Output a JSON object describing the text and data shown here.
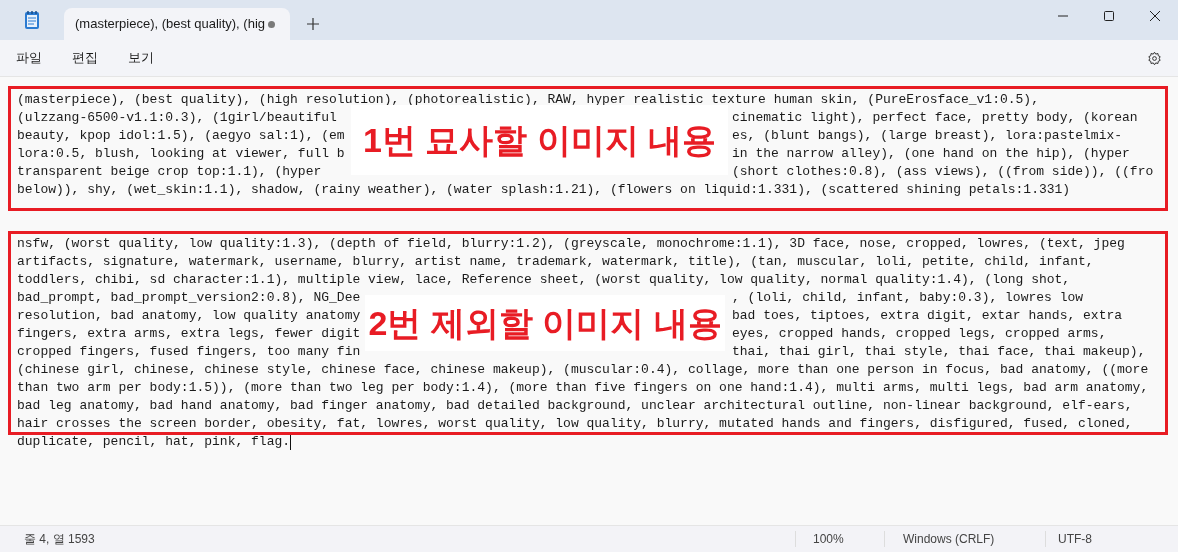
{
  "window": {
    "tab": {
      "title": "(masterpiece), (best quality), (hig",
      "unsaved": true
    }
  },
  "menu": [
    "파일",
    "편집",
    "보기"
  ],
  "document": {
    "paragraphs": [
      {
        "annotation": "1번 묘사할 이미지 내용",
        "lines": [
          [
            "(masterpiece), (best quality), (high resolution), (photorealistic), RAW, hyper realistic texture human skin, (PureErosface_v1:0.5),"
          ],
          [
            "(ulzzang-6500-v1.1:0.3), (1girl/beautiful",
            "cinematic light), perfect face, pretty body, (korean"
          ],
          [
            "beauty, kpop idol:1.5), (aegyo sal:1), (em",
            "es, (blunt bangs), (large breast), lora:pastelmix-"
          ],
          [
            "lora:0.5, blush, looking at viewer, full b",
            "in the narrow alley), (one hand on the hip), (hyper"
          ],
          [
            "transparent beige crop top:1.1), (hyper",
            "(short clothes:0.8), (ass views), ((from side)), ((fro"
          ],
          [
            "below)), shy, (wet_skin:1.1), shadow, (rainy weather), (water splash:1.21), (flowers on liquid:1.331), (scattered shining petals:1.331)"
          ]
        ]
      },
      {
        "annotation": "2번 제외할 이미지 내용",
        "lines": [
          [
            "nsfw, (worst quality, low quality:1.3), (depth of field, blurry:1.2), (greyscale, monochrome:1.1), 3D face, nose, cropped, lowres, (text, jpeg"
          ],
          [
            "artifacts, signature, watermark, username, blurry, artist name, trademark, watermark, title), (tan, muscular, loli, petite, child, infant,"
          ],
          [
            "toddlers, chibi, sd character:1.1), multiple view, lace, Reference sheet, (worst quality, low quality, normal quality:1.4), (long shot,"
          ],
          [
            "bad_prompt, bad_prompt_version2:0.8), NG_Dee",
            ", (loli, child, infant, baby:0.3), lowres low"
          ],
          [
            "resolution, bad anatomy, low quality anatomy",
            "bad toes, tiptoes, extra digit, extar hands, extra"
          ],
          [
            "fingers, extra arms, extra legs, fewer digit",
            "eyes, cropped hands, cropped legs, cropped arms,"
          ],
          [
            "cropped fingers, fused fingers, too many fin",
            "thai, thai girl, thai style, thai face, thai makeup),"
          ],
          [
            "(chinese girl, chinese, chinese style, chinese face, chinese makeup), (muscular:0.4), collage, more than one person in focus, bad anatomy, ((more"
          ],
          [
            "than two arm per body:1.5)), (more than two leg per body:1.4), (more than five fingers on one hand:1.4), multi arms, multi legs, bad arm anatomy,"
          ],
          [
            "bad leg anatomy, bad hand anatomy, bad finger anatomy, bad detailed background, unclear architectural outline, non-linear background, elf-ears,"
          ],
          [
            "hair crosses the screen border, obesity, fat, lowres, worst quality, low quality, blurry, mutated hands and fingers, disfigured, fused, cloned,"
          ]
        ],
        "after_box": [
          "duplicate, pencil, hat, pink, flag."
        ]
      }
    ]
  },
  "status_bar": {
    "position": "줄 4, 열 1593",
    "zoom": "100%",
    "line_ending": "Windows (CRLF)",
    "encoding": "UTF-8"
  }
}
